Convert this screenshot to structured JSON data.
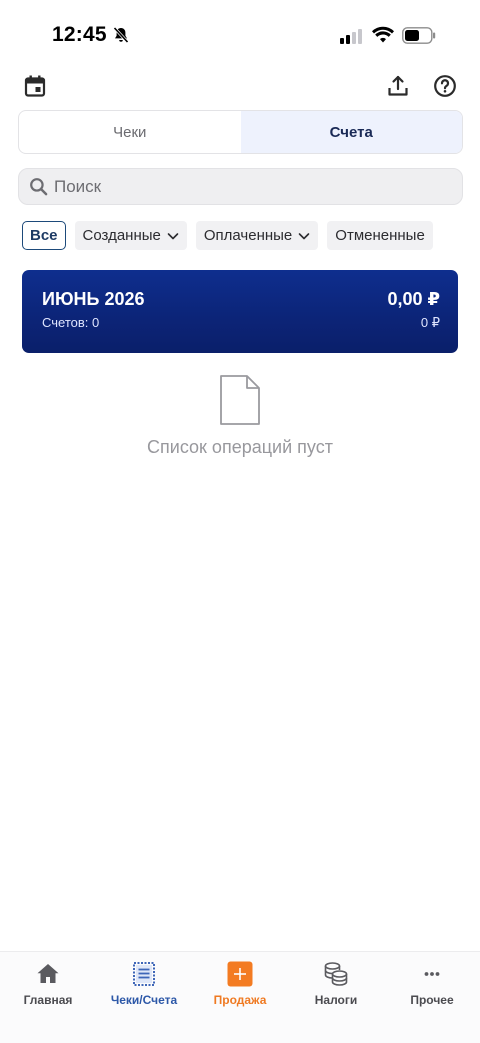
{
  "status_bar": {
    "time": "12:45"
  },
  "tabs": {
    "receipts": "Чеки",
    "invoices": "Счета",
    "active": "invoices"
  },
  "search": {
    "placeholder": "Поиск",
    "value": ""
  },
  "filters": [
    {
      "label": "Все",
      "active": true,
      "dropdown": false
    },
    {
      "label": "Созданные",
      "active": false,
      "dropdown": true
    },
    {
      "label": "Оплаченные",
      "active": false,
      "dropdown": true
    },
    {
      "label": "Отмененные",
      "active": false,
      "dropdown": false
    }
  ],
  "month_card": {
    "title": "ИЮНЬ 2026",
    "count": "Счетов: 0",
    "total": "0,00 ₽",
    "subtotal": "0 ₽",
    "color": "#0c2477"
  },
  "empty_state": {
    "text": "Список операций пуст",
    "icon": "document-icon"
  },
  "bottom_nav": {
    "items": [
      {
        "label": "Главная",
        "icon": "home-icon"
      },
      {
        "label": "Чеки/Счета",
        "icon": "receipt-icon"
      },
      {
        "label": "Продажа",
        "icon": "plus-icon"
      },
      {
        "label": "Налоги",
        "icon": "coins-icon"
      },
      {
        "label": "Прочее",
        "icon": "more-icon"
      }
    ],
    "active_index": 1,
    "accent": "#2d58a8",
    "sale_color": "#ef7a22"
  }
}
